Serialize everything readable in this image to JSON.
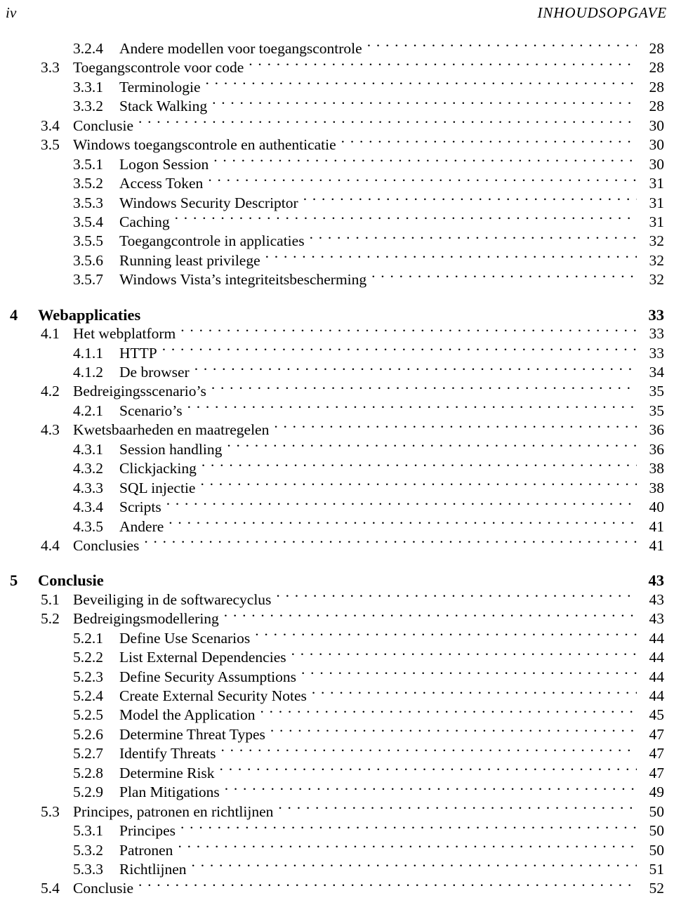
{
  "header": {
    "folio": "iv",
    "running_title": "INHOUDSOPGAVE"
  },
  "colors": {
    "text": "#000000",
    "page_background": "#ffffff"
  },
  "toc": {
    "entries": [
      {
        "level": "subsection",
        "number": "3.2.4",
        "title": "Andere modellen voor toegangscontrole",
        "page": "28",
        "gap_before": false
      },
      {
        "level": "section",
        "number": "3.3",
        "title": "Toegangscontrole voor code",
        "page": "28",
        "gap_before": false
      },
      {
        "level": "subsection",
        "number": "3.3.1",
        "title": "Terminologie",
        "page": "28",
        "gap_before": false
      },
      {
        "level": "subsection",
        "number": "3.3.2",
        "title": "Stack Walking",
        "page": "28",
        "gap_before": false
      },
      {
        "level": "section",
        "number": "3.4",
        "title": "Conclusie",
        "page": "30",
        "gap_before": false
      },
      {
        "level": "section",
        "number": "3.5",
        "title": "Windows toegangscontrole en authenticatie",
        "page": "30",
        "gap_before": false
      },
      {
        "level": "subsection",
        "number": "3.5.1",
        "title": "Logon Session",
        "page": "30",
        "gap_before": false
      },
      {
        "level": "subsection",
        "number": "3.5.2",
        "title": "Access Token",
        "page": "31",
        "gap_before": false
      },
      {
        "level": "subsection",
        "number": "3.5.3",
        "title": "Windows Security Descriptor",
        "page": "31",
        "gap_before": false
      },
      {
        "level": "subsection",
        "number": "3.5.4",
        "title": "Caching",
        "page": "31",
        "gap_before": false
      },
      {
        "level": "subsection",
        "number": "3.5.5",
        "title": "Toegangcontrole in applicaties",
        "page": "32",
        "gap_before": false
      },
      {
        "level": "subsection",
        "number": "3.5.6",
        "title": "Running least privilege",
        "page": "32",
        "gap_before": false
      },
      {
        "level": "subsection",
        "number": "3.5.7",
        "title": "Windows Vista’s integriteitsbescherming",
        "page": "32",
        "gap_before": false
      },
      {
        "level": "chapter",
        "number": "4",
        "title": "Webapplicaties",
        "page": "33",
        "gap_before": true
      },
      {
        "level": "section",
        "number": "4.1",
        "title": "Het webplatform",
        "page": "33",
        "gap_before": false
      },
      {
        "level": "subsection",
        "number": "4.1.1",
        "title": "HTTP",
        "page": "33",
        "gap_before": false
      },
      {
        "level": "subsection",
        "number": "4.1.2",
        "title": "De browser",
        "page": "34",
        "gap_before": false
      },
      {
        "level": "section",
        "number": "4.2",
        "title": "Bedreigingsscenario’s",
        "page": "35",
        "gap_before": false
      },
      {
        "level": "subsection",
        "number": "4.2.1",
        "title": "Scenario’s",
        "page": "35",
        "gap_before": false
      },
      {
        "level": "section",
        "number": "4.3",
        "title": "Kwetsbaarheden en maatregelen",
        "page": "36",
        "gap_before": false
      },
      {
        "level": "subsection",
        "number": "4.3.1",
        "title": "Session handling",
        "page": "36",
        "gap_before": false
      },
      {
        "level": "subsection",
        "number": "4.3.2",
        "title": "Clickjacking",
        "page": "38",
        "gap_before": false
      },
      {
        "level": "subsection",
        "number": "4.3.3",
        "title": "SQL injectie",
        "page": "38",
        "gap_before": false
      },
      {
        "level": "subsection",
        "number": "4.3.4",
        "title": "Scripts",
        "page": "40",
        "gap_before": false
      },
      {
        "level": "subsection",
        "number": "4.3.5",
        "title": "Andere",
        "page": "41",
        "gap_before": false
      },
      {
        "level": "section",
        "number": "4.4",
        "title": "Conclusies",
        "page": "41",
        "gap_before": false
      },
      {
        "level": "chapter",
        "number": "5",
        "title": "Conclusie",
        "page": "43",
        "gap_before": true
      },
      {
        "level": "section",
        "number": "5.1",
        "title": "Beveiliging in de softwarecyclus",
        "page": "43",
        "gap_before": false
      },
      {
        "level": "section",
        "number": "5.2",
        "title": "Bedreigingsmodellering",
        "page": "43",
        "gap_before": false
      },
      {
        "level": "subsection",
        "number": "5.2.1",
        "title": "Define Use Scenarios",
        "page": "44",
        "gap_before": false
      },
      {
        "level": "subsection",
        "number": "5.2.2",
        "title": "List External Dependencies",
        "page": "44",
        "gap_before": false
      },
      {
        "level": "subsection",
        "number": "5.2.3",
        "title": "Define Security Assumptions",
        "page": "44",
        "gap_before": false
      },
      {
        "level": "subsection",
        "number": "5.2.4",
        "title": "Create External Security Notes",
        "page": "44",
        "gap_before": false
      },
      {
        "level": "subsection",
        "number": "5.2.5",
        "title": "Model the Application",
        "page": "45",
        "gap_before": false
      },
      {
        "level": "subsection",
        "number": "5.2.6",
        "title": "Determine Threat Types",
        "page": "47",
        "gap_before": false
      },
      {
        "level": "subsection",
        "number": "5.2.7",
        "title": "Identify Threats",
        "page": "47",
        "gap_before": false
      },
      {
        "level": "subsection",
        "number": "5.2.8",
        "title": "Determine Risk",
        "page": "47",
        "gap_before": false
      },
      {
        "level": "subsection",
        "number": "5.2.9",
        "title": "Plan Mitigations",
        "page": "49",
        "gap_before": false
      },
      {
        "level": "section",
        "number": "5.3",
        "title": "Principes, patronen en richtlijnen",
        "page": "50",
        "gap_before": false
      },
      {
        "level": "subsection",
        "number": "5.3.1",
        "title": "Principes",
        "page": "50",
        "gap_before": false
      },
      {
        "level": "subsection",
        "number": "5.3.2",
        "title": "Patronen",
        "page": "50",
        "gap_before": false
      },
      {
        "level": "subsection",
        "number": "5.3.3",
        "title": "Richtlijnen",
        "page": "51",
        "gap_before": false
      },
      {
        "level": "section",
        "number": "5.4",
        "title": "Conclusie",
        "page": "52",
        "gap_before": false
      }
    ]
  }
}
